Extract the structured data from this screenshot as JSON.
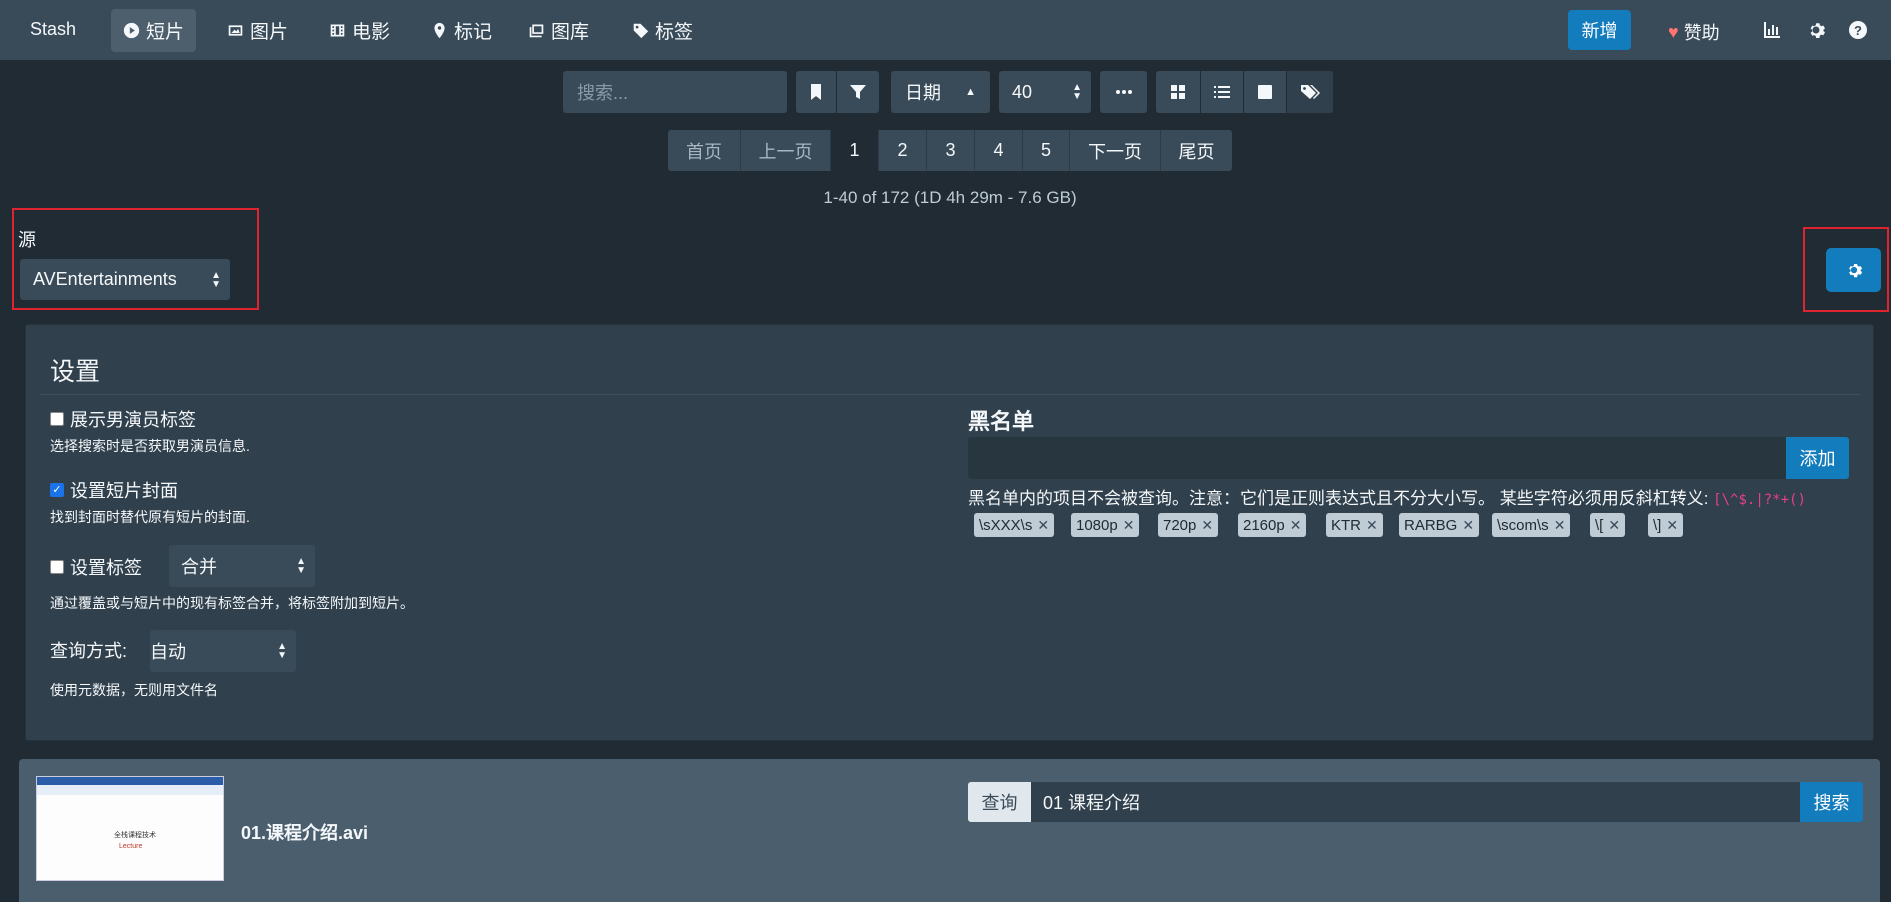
{
  "nav": {
    "brand": "Stash",
    "items": [
      {
        "label": "短片",
        "icon": "play-circle-icon"
      },
      {
        "label": "图片",
        "icon": "image-icon"
      },
      {
        "label": "电影",
        "icon": "film-icon"
      },
      {
        "label": "标记",
        "icon": "map-marker-icon"
      },
      {
        "label": "图库",
        "icon": "images-icon"
      },
      {
        "label": "标签",
        "icon": "tag-icon"
      }
    ],
    "new_label": "新增",
    "donate_label": "赞助"
  },
  "toolbar": {
    "search_placeholder": "搜索...",
    "sort_label": "日期",
    "per_page": "40"
  },
  "pagination": {
    "first": "首页",
    "prev": "上一页",
    "pages": [
      "1",
      "2",
      "3",
      "4",
      "5"
    ],
    "next": "下一页",
    "last": "尾页",
    "current": "1"
  },
  "stats": "1-40 of 172 (1D 4h 29m - 7.6 GB)",
  "source": {
    "label": "源",
    "value": "AVEntertainments"
  },
  "settings": {
    "title": "设置",
    "show_male": {
      "label": "展示男演员标签",
      "desc": "选择搜索时是否获取男演员信息.",
      "checked": false
    },
    "set_cover": {
      "label": "设置短片封面",
      "desc": "找到封面时替代原有短片的封面.",
      "checked": true
    },
    "set_tags": {
      "label": "设置标签",
      "mode": "合并",
      "desc": "通过覆盖或与短片中的现有标签合并，将标签附加到短片。",
      "checked": false
    },
    "query_mode": {
      "label": "查询方式:",
      "value": "自动",
      "desc": "使用元数据，无则用文件名"
    }
  },
  "blacklist": {
    "title": "黑名单",
    "add_label": "添加",
    "note": "黑名单内的项目不会被查询。注意：它们是正则表达式且不分大小写。 某些字符必须用反斜杠转义: ",
    "escape_chars": "[\\^$.|?*+()",
    "tags": [
      "\\sXXX\\s",
      "1080p",
      "720p",
      "2160p",
      "KTR",
      "RARBG",
      "\\scom\\s",
      "\\[",
      "\\]"
    ]
  },
  "scene": {
    "filename": "01.课程介绍.avi",
    "query_label": "查询",
    "query_value": "01 课程介绍",
    "search_label": "搜索",
    "thumb_title": "全栈课程技术",
    "thumb_subtitle": "Lecture"
  }
}
